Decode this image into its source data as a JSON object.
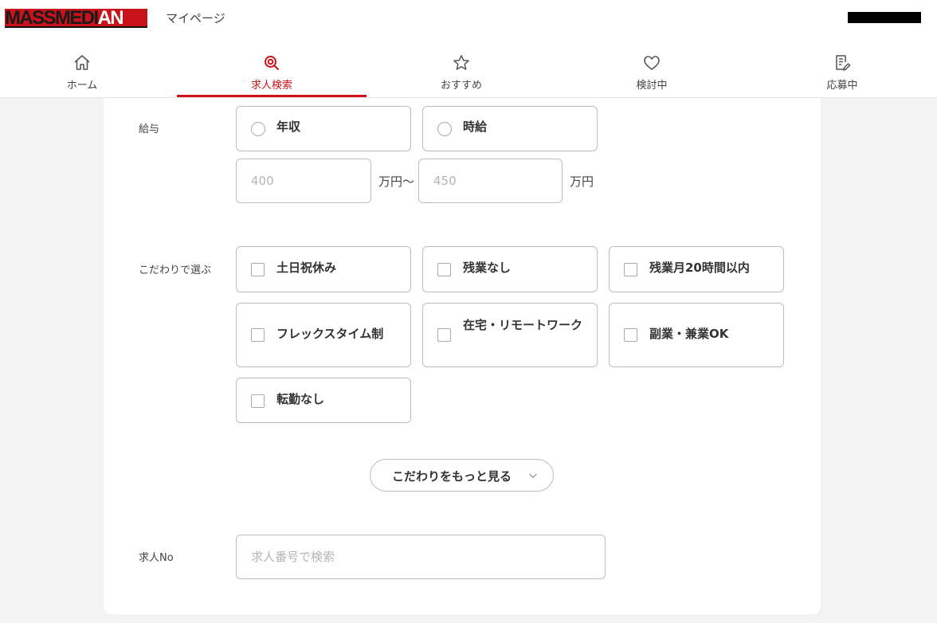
{
  "header": {
    "logo_main": "MASSMEDI",
    "logo_accent": "AN",
    "page_label": "マイページ"
  },
  "nav": {
    "items": [
      {
        "label": "ホーム",
        "icon": "home-icon"
      },
      {
        "label": "求人検索",
        "icon": "search-icon",
        "active": true
      },
      {
        "label": "おすすめ",
        "icon": "star-icon"
      },
      {
        "label": "検討中",
        "icon": "heart-icon"
      },
      {
        "label": "応募中",
        "icon": "document-icon"
      }
    ],
    "active_color": "#d0121b"
  },
  "salary": {
    "label": "給与",
    "options": [
      "年収",
      "時給"
    ],
    "min_placeholder": "400",
    "max_placeholder": "450",
    "range_unit": "万円〜",
    "unit": "万円"
  },
  "preferences": {
    "label": "こだわりで選ぶ",
    "options": [
      "土日祝休み",
      "残業なし",
      "残業月20時間以内",
      "フレックスタイム制",
      "在宅・リモートワーク",
      "副業・兼業OK",
      "転勤なし"
    ],
    "more_button": "こだわりをもっと見る"
  },
  "job_number": {
    "label": "求人No",
    "placeholder": "求人番号で検索"
  }
}
